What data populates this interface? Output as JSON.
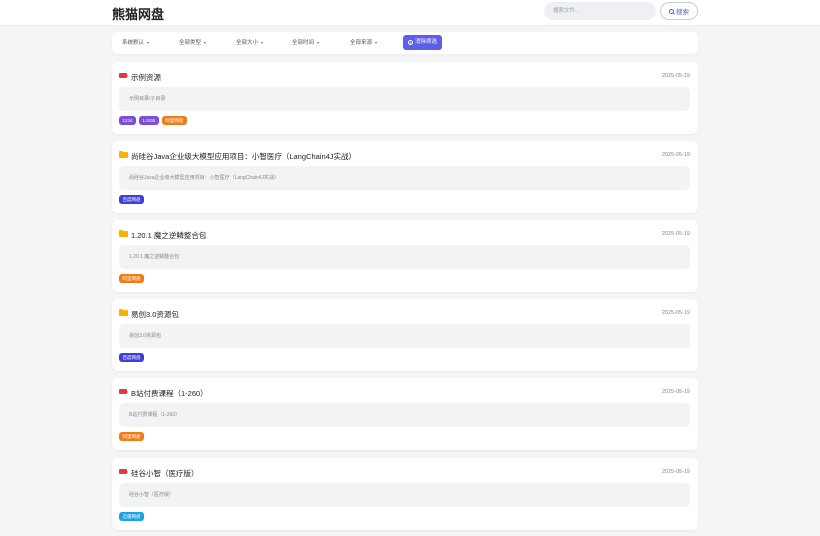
{
  "app": {
    "title": "熊猫网盘"
  },
  "search": {
    "placeholder": "搜索文件...",
    "button_label": "搜索"
  },
  "filters": [
    {
      "label": "系统默认"
    },
    {
      "label": "全部类型"
    },
    {
      "label": "全部大小"
    },
    {
      "label": "全部时间"
    },
    {
      "label": "全部来源"
    }
  ],
  "clear_filters_label": "消除筛选",
  "colors": {
    "accent": "#5b5ee8",
    "video_icon": "#e0354a",
    "folder_icon": "#f5b400"
  },
  "results": [
    {
      "icon": "video-icon",
      "title": "示例资源",
      "date": "2025-05-19",
      "path": "示例目录/子目录",
      "tags": [
        {
          "text": "1234",
          "color": "#7b4fd6"
        },
        {
          "text": "1.5GB",
          "color": "#7b4fd6"
        },
        {
          "text": "阿里网盘",
          "color": "#f07c18"
        }
      ]
    },
    {
      "icon": "folder-icon",
      "title": "尚硅谷Java企业级大模型应用项目：小智医疗（LangChain4J实战）",
      "date": "2025-05-19",
      "path": "尚硅谷Java企业级大模型应用项目：小智医疗（LangChain4J实战）",
      "tags": [
        {
          "text": "百度网盘",
          "color": "#3d3fd6"
        }
      ]
    },
    {
      "icon": "folder-icon",
      "title": "1.20.1 魔之逆鳞整合包",
      "date": "2025-05-19",
      "path": "1.20.1 魔之逆鳞整合包",
      "tags": [
        {
          "text": "阿里网盘",
          "color": "#f07c18"
        }
      ]
    },
    {
      "icon": "folder-icon",
      "title": "易创3.0资源包",
      "date": "2025-05-19",
      "path": "易创3.0资源包",
      "tags": [
        {
          "text": "百度网盘",
          "color": "#3d3fd6"
        }
      ]
    },
    {
      "icon": "video-icon",
      "title": "B站付费课程（1-260）",
      "date": "2025-05-19",
      "path": "B站付费课程（1-260）",
      "tags": [
        {
          "text": "阿里网盘",
          "color": "#f07c18"
        }
      ]
    },
    {
      "icon": "video-icon",
      "title": "硅谷小智（医疗版）",
      "date": "2025-05-19",
      "path": "硅谷小智（医疗版）",
      "tags": [
        {
          "text": "迅雷网盘",
          "color": "#1da1e6"
        }
      ]
    }
  ]
}
